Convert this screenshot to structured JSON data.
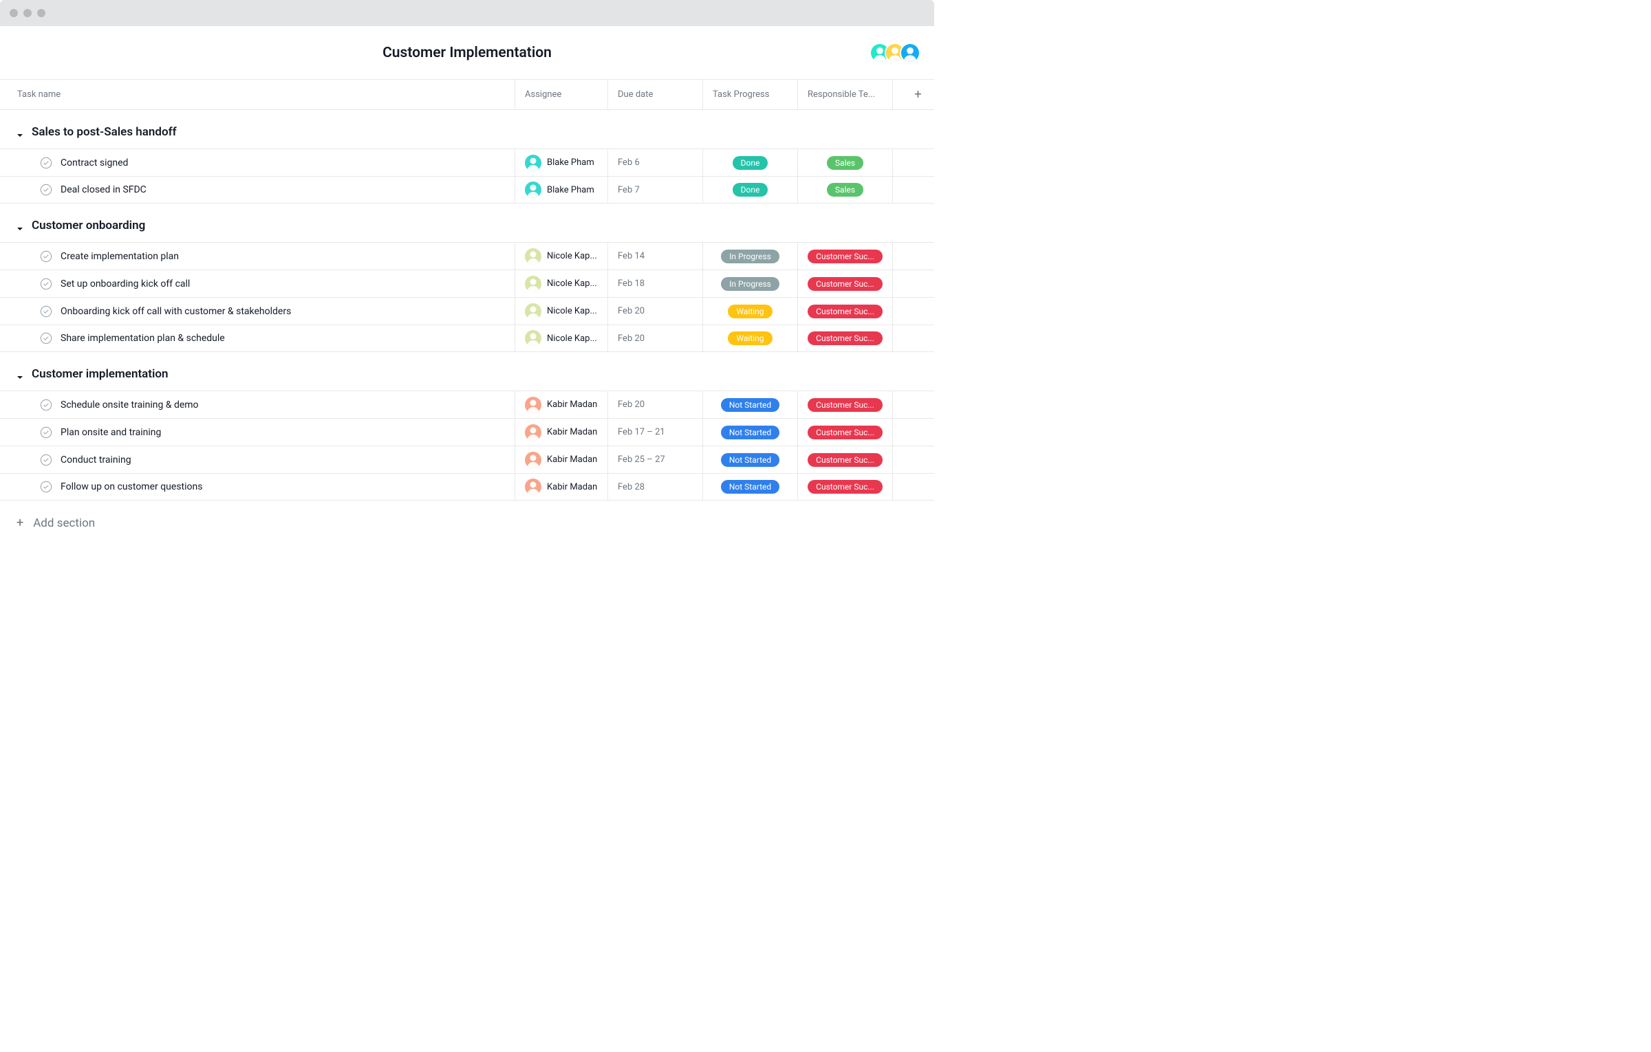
{
  "header": {
    "title": "Customer Implementation",
    "avatars": [
      {
        "bg": "#25e8c8"
      },
      {
        "bg": "#ffd54a"
      },
      {
        "bg": "#14aaf5"
      }
    ]
  },
  "columns": {
    "task_name": "Task name",
    "assignee": "Assignee",
    "due_date": "Due date",
    "progress": "Task Progress",
    "team": "Responsible Te..."
  },
  "pill_colors": {
    "Done": "#25c3a9",
    "In Progress": "#8da3a6",
    "Waiting": "#ffc310",
    "Not Started": "#2f80ed",
    "Sales": "#5ac46b",
    "Customer Success": "#e8384f"
  },
  "assignee_avatars": {
    "Blake Pham": "#36d7d0",
    "Nicole Kappel": "#d9e5a8",
    "Kabir Madan": "#f7a58b"
  },
  "sections": [
    {
      "title": "Sales to post-Sales handoff",
      "tasks": [
        {
          "name": "Contract signed",
          "assignee": "Blake Pham",
          "assignee_display": "Blake Pham",
          "due": "Feb 6",
          "progress": "Done",
          "team": "Sales",
          "team_display": "Sales"
        },
        {
          "name": "Deal closed in SFDC",
          "assignee": "Blake Pham",
          "assignee_display": "Blake Pham",
          "due": "Feb 7",
          "progress": "Done",
          "team": "Sales",
          "team_display": "Sales"
        }
      ]
    },
    {
      "title": "Customer onboarding",
      "tasks": [
        {
          "name": "Create implementation plan",
          "assignee": "Nicole Kappel",
          "assignee_display": "Nicole Kap...",
          "due": "Feb 14",
          "progress": "In Progress",
          "team": "Customer Success",
          "team_display": "Customer Suc..."
        },
        {
          "name": "Set up onboarding kick off call",
          "assignee": "Nicole Kappel",
          "assignee_display": "Nicole Kap...",
          "due": "Feb 18",
          "progress": "In Progress",
          "team": "Customer Success",
          "team_display": "Customer Suc..."
        },
        {
          "name": "Onboarding kick off call with customer & stakeholders",
          "assignee": "Nicole Kappel",
          "assignee_display": "Nicole Kap...",
          "due": "Feb 20",
          "progress": "Waiting",
          "team": "Customer Success",
          "team_display": "Customer Suc..."
        },
        {
          "name": "Share implementation plan & schedule",
          "assignee": "Nicole Kappel",
          "assignee_display": "Nicole Kap...",
          "due": "Feb 20",
          "progress": "Waiting",
          "team": "Customer Success",
          "team_display": "Customer Suc..."
        }
      ]
    },
    {
      "title": "Customer implementation",
      "tasks": [
        {
          "name": "Schedule onsite training & demo",
          "assignee": "Kabir Madan",
          "assignee_display": "Kabir Madan",
          "due": "Feb 20",
          "progress": "Not Started",
          "team": "Customer Success",
          "team_display": "Customer Suc..."
        },
        {
          "name": "Plan onsite and training",
          "assignee": "Kabir Madan",
          "assignee_display": "Kabir Madan",
          "due": "Feb 17 – 21",
          "progress": "Not Started",
          "team": "Customer Success",
          "team_display": "Customer Suc..."
        },
        {
          "name": "Conduct training",
          "assignee": "Kabir Madan",
          "assignee_display": "Kabir Madan",
          "due": "Feb 25 – 27",
          "progress": "Not Started",
          "team": "Customer Success",
          "team_display": "Customer Suc..."
        },
        {
          "name": "Follow up on customer questions",
          "assignee": "Kabir Madan",
          "assignee_display": "Kabir Madan",
          "due": "Feb 28",
          "progress": "Not Started",
          "team": "Customer Success",
          "team_display": "Customer Suc..."
        }
      ]
    }
  ],
  "add_section_label": "Add section"
}
